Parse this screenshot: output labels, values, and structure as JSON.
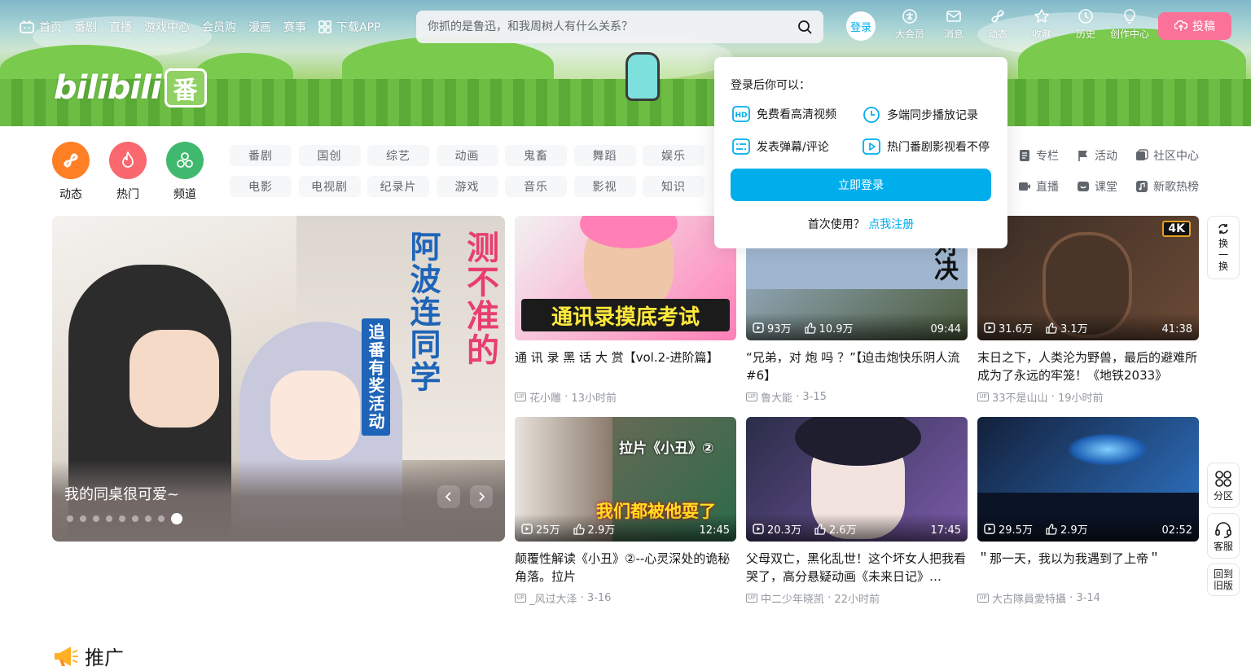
{
  "header": {
    "nav": [
      {
        "label": "首页",
        "icon": "tv-icon"
      },
      {
        "label": "番剧"
      },
      {
        "label": "直播"
      },
      {
        "label": "游戏中心"
      },
      {
        "label": "会员购"
      },
      {
        "label": "漫画"
      },
      {
        "label": "赛事"
      },
      {
        "label": "下载APP",
        "icon": "app-grid-icon"
      }
    ],
    "search": {
      "placeholder": "你抓的是鲁迅，和我周树人有什么关系？"
    },
    "login_label": "登录",
    "right_nav": [
      {
        "label": "大会员",
        "icon": "vip-icon"
      },
      {
        "label": "消息",
        "icon": "message-icon"
      },
      {
        "label": "动态",
        "icon": "dynamic-icon"
      },
      {
        "label": "收藏",
        "icon": "favorite-icon"
      },
      {
        "label": "历史",
        "icon": "history-icon"
      },
      {
        "label": "创作中心",
        "icon": "creator-icon"
      }
    ],
    "upload_label": "投稿",
    "logo_text": "bilibili",
    "logo_badge": "番"
  },
  "channels": {
    "circles": [
      {
        "label": "动态",
        "color": "#ff7f24"
      },
      {
        "label": "热门",
        "color": "#f9686e"
      },
      {
        "label": "频道",
        "color": "#40b96e"
      }
    ],
    "chips": [
      [
        "番剧",
        "国创",
        "综艺",
        "动画",
        "鬼畜",
        "舞蹈",
        "娱乐"
      ],
      [
        "电影",
        "电视剧",
        "纪录片",
        "游戏",
        "音乐",
        "影视",
        "知识"
      ]
    ],
    "right_links": [
      [
        "专栏",
        "活动",
        "社区中心"
      ],
      [
        "直播",
        "课堂",
        "新歌热榜"
      ]
    ]
  },
  "carousel": {
    "caption": "我的同桌很可爱~",
    "title_art_a": "测不准的",
    "title_art_b": "阿波连同学",
    "title_art_c": "追番有奖活动",
    "dot_count": 9,
    "active_dot": 8
  },
  "cards": [
    {
      "title": "通 讯 录 黑 话 大 赏【vol.2-进阶篇】",
      "author": "花小雕",
      "time": "13小时前",
      "views": "",
      "likes": "",
      "duration": "",
      "thumb_text": "通讯录摸底考试",
      "colors": [
        "#f2f2f2",
        "#ff7fb6"
      ]
    },
    {
      "title": "“兄弟，对 炮 吗 ？”【迫击炮快乐阴人流#6】",
      "author": "鲁大能",
      "time": "3-15",
      "views": "93万",
      "likes": "10.9万",
      "duration": "09:44",
      "thumb_text": "对决",
      "colors": [
        "#9fb6d0",
        "#4a5a3a"
      ]
    },
    {
      "title": "末日之下，人类沦为野兽，最后的避难所成为了永远的牢笼！《地铁2033》",
      "author": "33不是山山",
      "time": "19小时前",
      "views": "31.6万",
      "likes": "3.1万",
      "duration": "41:38",
      "thumb_text": "4K",
      "colors": [
        "#3a2d25",
        "#6b4a36"
      ]
    },
    {
      "title": "颠覆性解读《小丑》②--心灵深处的诡秘角落。拉片",
      "author": "_风过大泽",
      "time": "3-16",
      "views": "25万",
      "likes": "2.9万",
      "duration": "12:45",
      "thumb_text": "拉片《小丑》②",
      "thumb_text2": "我们都被他耍了",
      "colors": [
        "#7c6a5a",
        "#2c6a4a"
      ]
    },
    {
      "title": "父母双亡，黑化乱世！这个坏女人把我看哭了，高分悬疑动画《未来日记》…",
      "author": "中二少年晓凯",
      "time": "22小时前",
      "views": "20.3万",
      "likes": "2.6万",
      "duration": "17:45",
      "thumb_text": "",
      "colors": [
        "#2a2d48",
        "#7a5aa8"
      ]
    },
    {
      "title": "＂那一天，我以为我遇到了上帝＂",
      "author": "大古隊員愛特攝",
      "time": "3-14",
      "views": "29.5万",
      "likes": "2.9万",
      "duration": "02:52",
      "thumb_text": "",
      "colors": [
        "#13203a",
        "#2f76c9"
      ]
    }
  ],
  "popup": {
    "heading": "登录后你可以：",
    "features": [
      {
        "label": "免费看高清视频",
        "icon": "hd-icon"
      },
      {
        "label": "多端同步播放记录",
        "icon": "clock-sync-icon"
      },
      {
        "label": "发表弹幕/评论",
        "icon": "danmaku-icon"
      },
      {
        "label": "热门番剧影视看不停",
        "icon": "play-box-icon"
      }
    ],
    "button": "立即登录",
    "register_prompt": "首次使用？",
    "register_link": "点我注册"
  },
  "side_tools": [
    {
      "label": "换一换",
      "icon": "refresh-icon"
    },
    {
      "label": "分区",
      "icon": "category-icon"
    },
    {
      "label": "客服",
      "icon": "headset-icon"
    },
    {
      "label": "回到旧版",
      "icon": ""
    }
  ],
  "promo_title": "推广",
  "colors": {
    "accent": "#00aeec",
    "pink": "#fb7299",
    "text": "#18191c",
    "muted": "#9499a0"
  }
}
